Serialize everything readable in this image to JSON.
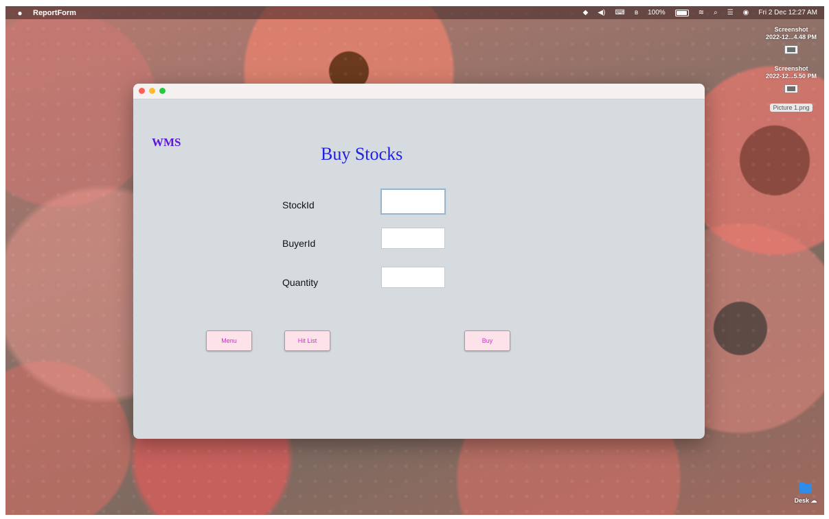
{
  "menubar": {
    "app_name": "ReportForm",
    "battery": "100%",
    "datetime": "Fri 2 Dec  12:27 AM"
  },
  "desktop_icons": [
    {
      "label_line1": "Screenshot",
      "label_line2": "2022-12...4.48 PM"
    },
    {
      "label_line1": "Screenshot",
      "label_line2": "2022-12...5.50 PM"
    },
    {
      "label": "Picture 1.png"
    },
    {
      "label": "Desk"
    }
  ],
  "window": {
    "logo": "WMS",
    "title": "Buy Stocks",
    "fields": [
      {
        "label": "StockId",
        "value": ""
      },
      {
        "label": "BuyerId",
        "value": ""
      },
      {
        "label": "Quantity",
        "value": ""
      }
    ],
    "buttons": {
      "menu": "Menu",
      "hit_list": "Hit List",
      "buy": "Buy"
    }
  },
  "colors": {
    "logo": "#5a17d8",
    "title": "#1f1fe8",
    "button_text": "#d12bd0",
    "button_bg": "#fde2ea",
    "window_bg": "#d6dbe0"
  }
}
